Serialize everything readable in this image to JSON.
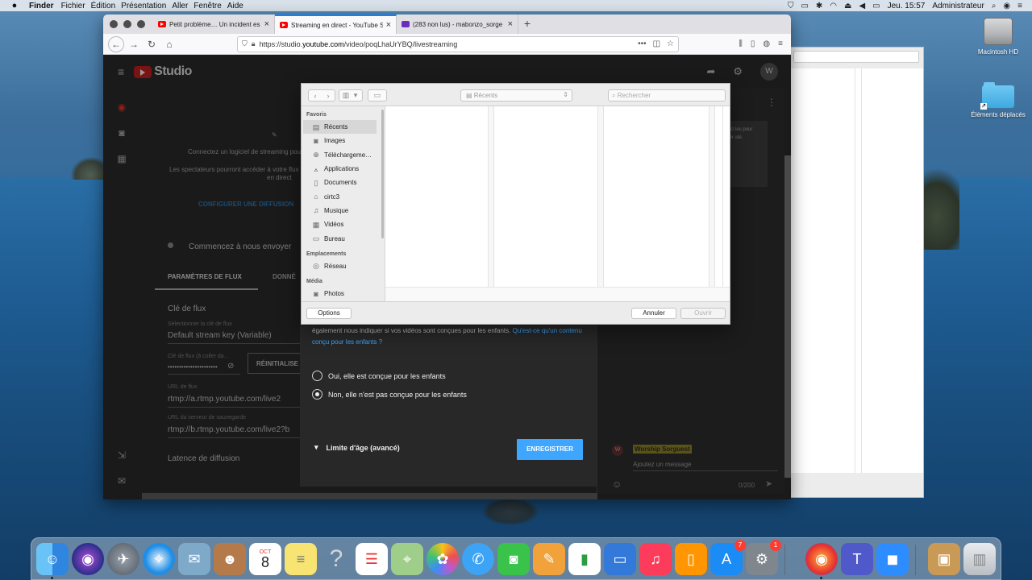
{
  "menubar": {
    "app": "Finder",
    "items": [
      "Fichier",
      "Édition",
      "Présentation",
      "Aller",
      "Fenêtre",
      "Aide"
    ],
    "clock": "Jeu. 15:57",
    "user": "Administrateur"
  },
  "desktop": {
    "icons": [
      {
        "label": "Macintosh HD",
        "icon": "hard-drive-icon"
      },
      {
        "label": "Éléments déplacés",
        "icon": "folder-alias-icon"
      }
    ]
  },
  "browser": {
    "tabs": [
      {
        "title": "Petit problème… Un incident es",
        "icon": "youtube-icon",
        "active": false
      },
      {
        "title": "Streaming en direct - YouTube S",
        "icon": "youtube-icon",
        "active": true
      },
      {
        "title": "(283 non lus) - mabonzo_sorge",
        "icon": "yahoo-icon",
        "active": false
      }
    ],
    "url_prefix": "https://studio.",
    "url_domain": "youtube.com",
    "url_path": "/video/poqLhaUrYBQ/livestreaming"
  },
  "studio": {
    "logo": "Studio",
    "avatar": "W",
    "connect_text_1": "Connectez un logiciel de streaming pou",
    "connect_text_2": "Les spectateurs pourront accéder à votre flux",
    "connect_text_3": "en direct",
    "configure_link": "CONFIGURER UNE DIFFUSION",
    "start_sending": "Commencez à nous envoyer",
    "tab_stream_settings": "PARAMÈTRES DE FLUX",
    "tab_data": "DONNÉ",
    "stream_key_heading": "Clé de flux",
    "stream_key_select_label": "Sélectionner la clé de flux",
    "stream_key_select_value": "Default stream key (Variable)",
    "stream_key_paste_label": "Clé de flux (à coller da…",
    "stream_key_masked": "••••••••••••••••••••••",
    "reset_button": "RÉINITIALISE",
    "stream_url_label": "URL de flux",
    "stream_url_value": "rtmp://a.rtmp.youtube.com/live2",
    "backup_url_label": "URL du serveur de sauvegarde",
    "backup_url_value": "rtmp://b.rtmp.youtube.com/live2?b",
    "latency_heading": "Latence de diffusion"
  },
  "chat": {
    "notice": "l Veillez les pour specter uté.",
    "author_avatar": "W",
    "author": "Worship Sorguest",
    "input_placeholder": "Ajoutez un message",
    "counter": "0/200"
  },
  "yt_dialog": {
    "kids_text": "également nous indiquer si vos vidéos sont conçues pour les enfants.",
    "kids_link": "Qu'est-ce qu'un contenu conçu pour les enfants ?",
    "option_yes": "Oui, elle est conçue pour les enfants",
    "option_no": "Non, elle n'est pas conçue pour les enfants",
    "selected": "no",
    "age_limit": "Limite d'âge (avancé)",
    "save_button": "ENREGISTRER"
  },
  "open_sheet": {
    "location": "Récents",
    "search_placeholder": "Rechercher",
    "favorites_heading": "Favoris",
    "favorites": [
      {
        "label": "Récents",
        "icon": "recents-icon",
        "selected": true
      },
      {
        "label": "Images",
        "icon": "camera-icon",
        "selected": false
      },
      {
        "label": "Téléchargeme…",
        "icon": "download-icon",
        "selected": false
      },
      {
        "label": "Applications",
        "icon": "applications-icon",
        "selected": false
      },
      {
        "label": "Documents",
        "icon": "document-icon",
        "selected": false
      },
      {
        "label": "cirtc3",
        "icon": "home-icon",
        "selected": false
      },
      {
        "label": "Musique",
        "icon": "music-icon",
        "selected": false
      },
      {
        "label": "Vidéos",
        "icon": "film-icon",
        "selected": false
      },
      {
        "label": "Bureau",
        "icon": "desktop-icon",
        "selected": false
      }
    ],
    "locations_heading": "Emplacements",
    "locations": [
      {
        "label": "Réseau",
        "icon": "network-icon"
      }
    ],
    "media_heading": "Média",
    "media": [
      {
        "label": "Photos",
        "icon": "camera-icon"
      }
    ],
    "options_button": "Options",
    "cancel_button": "Annuler",
    "open_button": "Ouvrir"
  },
  "dock": {
    "calendar_month": "OCT",
    "calendar_day": "8",
    "appstore_badge": "7",
    "prefs_badge": "1",
    "teams_letter": "T"
  }
}
